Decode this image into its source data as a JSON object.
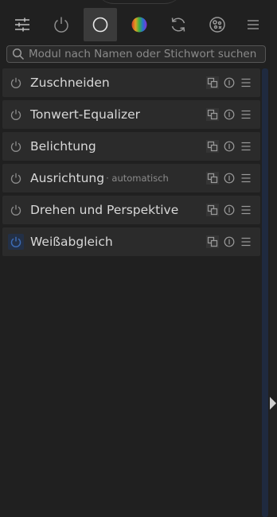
{
  "search": {
    "placeholder": "Modul nach Namen oder Stichwort suchen"
  },
  "tabs": [
    {
      "icon": "sliders-icon",
      "active": false
    },
    {
      "icon": "power-icon",
      "active": false
    },
    {
      "icon": "circle-icon",
      "active": true
    },
    {
      "icon": "color-wheel-icon",
      "active": false
    },
    {
      "icon": "refresh-icon",
      "active": false
    },
    {
      "icon": "effects-icon",
      "active": false
    },
    {
      "icon": "menu-icon",
      "active": false
    }
  ],
  "modules": [
    {
      "name": "Zuschneiden",
      "sub": "",
      "enabled": false
    },
    {
      "name": "Tonwert-Equalizer",
      "sub": "",
      "enabled": false
    },
    {
      "name": "Belichtung",
      "sub": "",
      "enabled": false
    },
    {
      "name": "Ausrichtung",
      "sub": "· automatisch",
      "enabled": false
    },
    {
      "name": "Drehen und Perspektive",
      "sub": "",
      "enabled": false
    },
    {
      "name": "Weißabgleich",
      "sub": "",
      "enabled": true
    }
  ],
  "colors": {
    "background": "#202020",
    "module_bg": "#2b2b2b",
    "text": "#d8d8d8",
    "accent_blue": "#3d6bb3",
    "scrollbar": "#1f2a3f"
  }
}
